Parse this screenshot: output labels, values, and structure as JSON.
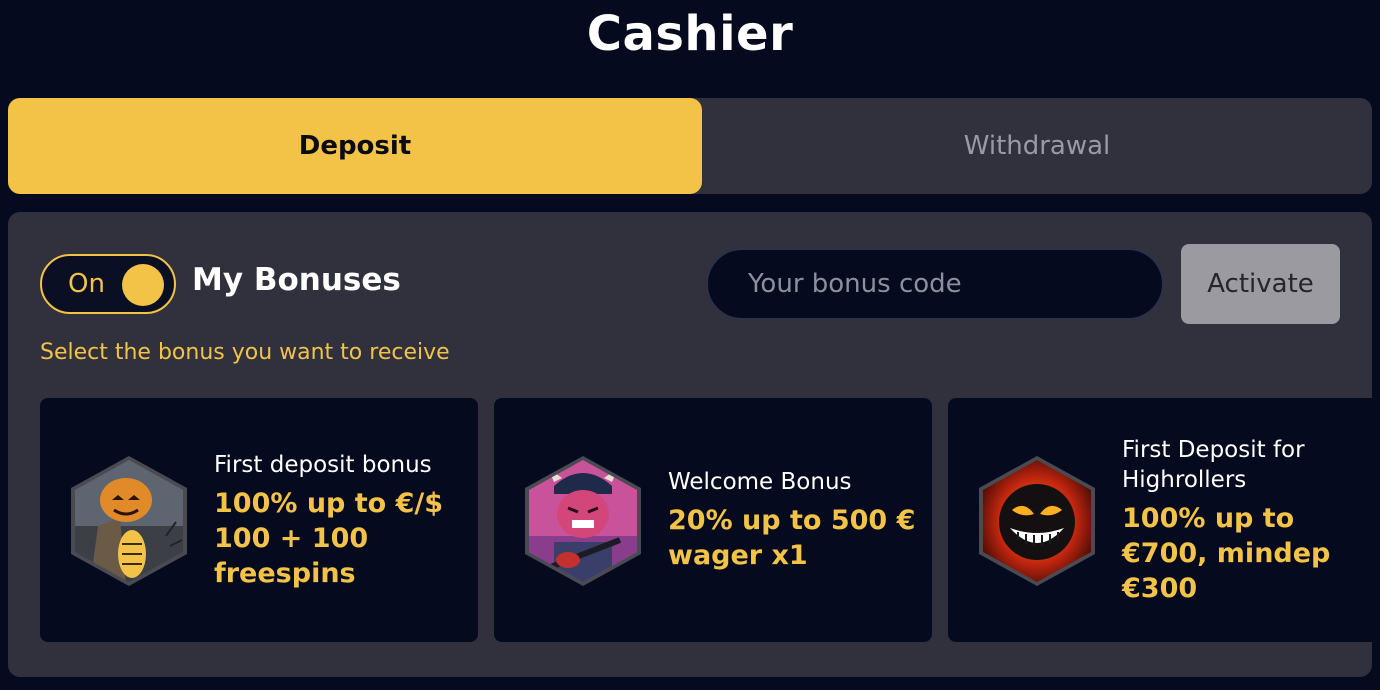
{
  "page": {
    "title": "Cashier"
  },
  "tabs": [
    {
      "label": "Deposit",
      "active": true
    },
    {
      "label": "Withdrawal",
      "active": false
    }
  ],
  "bonuses": {
    "toggle_label": "On",
    "toggle_on": true,
    "title": "My Bonuses",
    "code_placeholder": "Your bonus code",
    "code_value": "",
    "activate_label": "Activate",
    "hint": "Select the bonus you want to receive"
  },
  "cards": [
    {
      "title": "First deposit bonus",
      "description": "100% up to €/$ 100 + 100 freespins",
      "icon": "pumpkin-scarecrow-icon"
    },
    {
      "title": "Welcome Bonus",
      "description": "20% up to 500 € wager x1",
      "icon": "devil-guitarist-icon"
    },
    {
      "title": "First Deposit for Highrollers",
      "description": "100% up to €700, mindep €300",
      "icon": "evil-face-icon"
    }
  ],
  "colors": {
    "background": "#050a1e",
    "panel": "#31313d",
    "accent": "#f2c347",
    "muted_text": "#9a9aa6",
    "activate_button": "#9a9aa0"
  }
}
